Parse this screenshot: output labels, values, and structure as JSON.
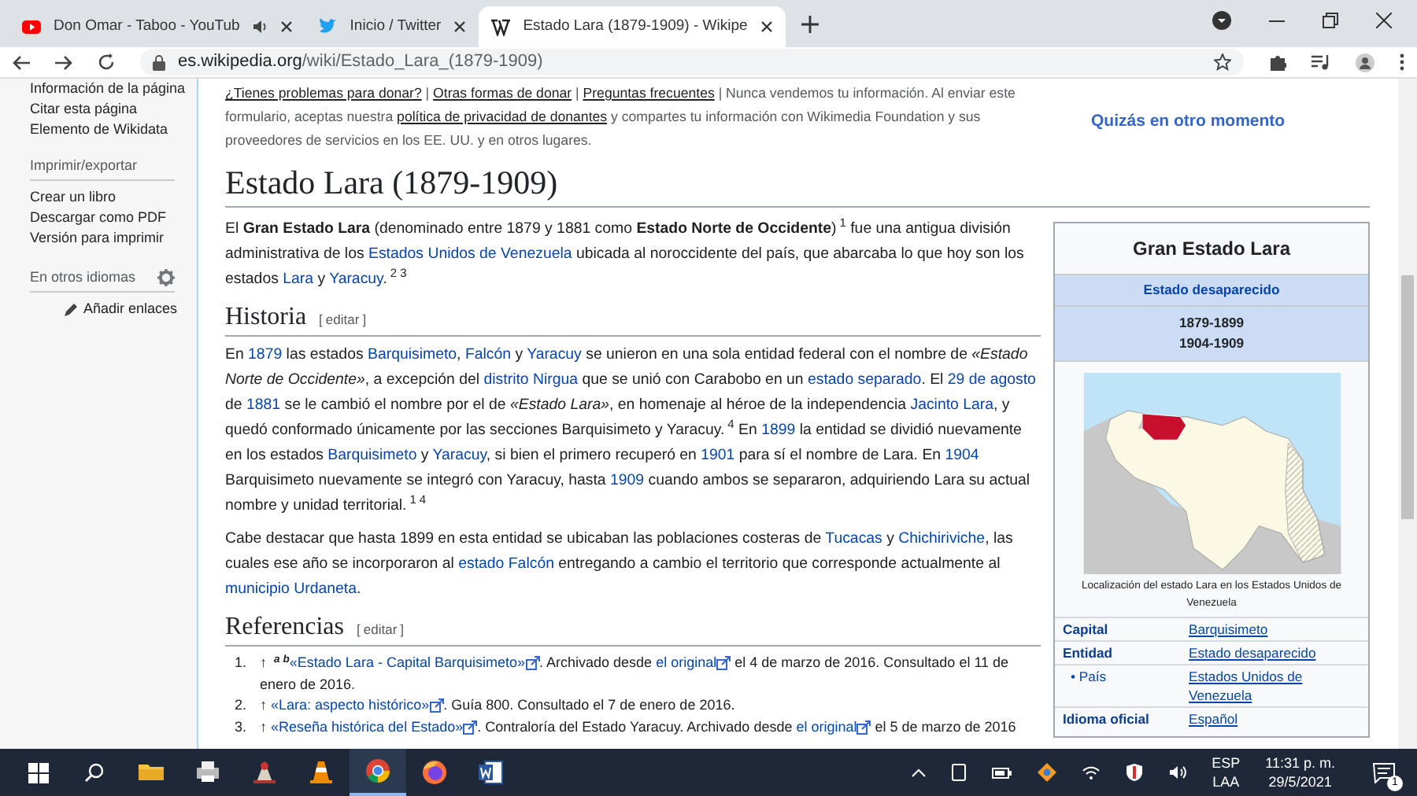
{
  "browser": {
    "tabs": [
      {
        "title": "Don Omar - Taboo - YouTub",
        "kind": "youtube",
        "selected": false,
        "playing_audio": true
      },
      {
        "title": "Inicio / Twitter",
        "kind": "twitter",
        "selected": false,
        "playing_audio": false
      },
      {
        "title": "Estado Lara (1879-1909) - Wikipe",
        "kind": "wikipedia",
        "selected": true,
        "playing_audio": false
      }
    ],
    "url_host": "es.wikipedia.org",
    "url_path": "/wiki/Estado_Lara_(1879-1909)"
  },
  "sidebar": {
    "top_links": [
      "Información de la página",
      "Citar esta página",
      "Elemento de Wikidata"
    ],
    "sections": [
      {
        "heading": "Imprimir/exportar",
        "links": [
          "Crear un libro",
          "Descargar como PDF",
          "Versión para imprimir"
        ]
      }
    ],
    "languages": {
      "heading": "En otros idiomas",
      "add_links": "Añadir enlaces"
    }
  },
  "banner": {
    "segments": [
      {
        "kind": "ulink",
        "text": "¿Tienes problemas para donar?"
      },
      {
        "kind": "text",
        "text": " | "
      },
      {
        "kind": "ulink",
        "text": "Otras formas de donar"
      },
      {
        "kind": "text",
        "text": " | "
      },
      {
        "kind": "ulink",
        "text": "Preguntas frecuentes"
      },
      {
        "kind": "text",
        "text": " | Nunca vendemos tu información. Al enviar este formulario, aceptas nuestra "
      },
      {
        "kind": "ulink",
        "text": "política de privacidad de donantes"
      },
      {
        "kind": "text",
        "text": " y compartes tu información con Wikimedia Foundation y sus proveedores de servicios en los EE. UU. y en otros lugares."
      }
    ],
    "action": "Quizás en otro momento"
  },
  "article": {
    "title": "Estado Lara (1879-1909)",
    "intro": [
      [
        {
          "kind": "text",
          "text": "El "
        },
        {
          "kind": "bold",
          "text": "Gran Estado Lara"
        },
        {
          "kind": "text",
          "text": " (denominado entre 1879 y 1881 como "
        },
        {
          "kind": "bold",
          "text": "Estado Norte de Occidente"
        },
        {
          "kind": "text",
          "text": ")"
        },
        {
          "kind": "ref",
          "text": "1"
        },
        {
          "kind": "text",
          "text": "  fue una antigua división administrativa de los "
        },
        {
          "kind": "link",
          "text": "Estados Unidos de Venezuela"
        },
        {
          "kind": "text",
          "text": " ubicada al noroccidente del país, que abarcaba lo que hoy son los estados "
        },
        {
          "kind": "link",
          "text": "Lara"
        },
        {
          "kind": "text",
          "text": " y "
        },
        {
          "kind": "link",
          "text": "Yaracuy"
        },
        {
          "kind": "text",
          "text": "."
        },
        {
          "kind": "ref",
          "text": "2"
        },
        {
          "kind": "ref",
          "text": "3"
        }
      ]
    ],
    "sections": [
      {
        "heading": "Historia",
        "edit_open": "[",
        "edit": "editar",
        "edit_close": "]",
        "paragraphs": [
          [
            {
              "kind": "text",
              "text": "En "
            },
            {
              "kind": "link",
              "text": "1879"
            },
            {
              "kind": "text",
              "text": " las estados "
            },
            {
              "kind": "link",
              "text": "Barquisimeto"
            },
            {
              "kind": "text",
              "text": ", "
            },
            {
              "kind": "link",
              "text": "Falcón"
            },
            {
              "kind": "text",
              "text": " y "
            },
            {
              "kind": "link",
              "text": "Yaracuy"
            },
            {
              "kind": "text",
              "text": " se unieron en una sola entidad federal con el nombre de "
            },
            {
              "kind": "italic",
              "text": "«Estado Norte de Occidente»"
            },
            {
              "kind": "text",
              "text": ", a excepción del "
            },
            {
              "kind": "link",
              "text": "distrito Nirgua"
            },
            {
              "kind": "text",
              "text": " que se unió con Carabobo en un "
            },
            {
              "kind": "link",
              "text": "estado separado"
            },
            {
              "kind": "text",
              "text": ". El "
            },
            {
              "kind": "link",
              "text": "29 de agosto"
            },
            {
              "kind": "text",
              "text": " de "
            },
            {
              "kind": "link",
              "text": "1881"
            },
            {
              "kind": "text",
              "text": " se le cambió el nombre por el de "
            },
            {
              "kind": "italic",
              "text": "«Estado Lara»"
            },
            {
              "kind": "text",
              "text": ", en homenaje al héroe de la independencia "
            },
            {
              "kind": "link",
              "text": "Jacinto Lara"
            },
            {
              "kind": "text",
              "text": ", y quedó conformado únicamente por las secciones Barquisimeto y Yaracuy."
            },
            {
              "kind": "ref",
              "text": "4"
            },
            {
              "kind": "text",
              "text": "  En "
            },
            {
              "kind": "link",
              "text": "1899"
            },
            {
              "kind": "text",
              "text": " la entidad se dividió nuevamente en los estados "
            },
            {
              "kind": "link",
              "text": "Barquisimeto"
            },
            {
              "kind": "text",
              "text": " y "
            },
            {
              "kind": "link",
              "text": "Yaracuy"
            },
            {
              "kind": "text",
              "text": ", si bien el primero recuperó en "
            },
            {
              "kind": "link",
              "text": "1901"
            },
            {
              "kind": "text",
              "text": " para sí el nombre de Lara. En "
            },
            {
              "kind": "link",
              "text": "1904"
            },
            {
              "kind": "text",
              "text": " Barquisimeto nuevamente se integró con Yaracuy, hasta "
            },
            {
              "kind": "link",
              "text": "1909"
            },
            {
              "kind": "text",
              "text": " cuando ambos se separaron, adquiriendo Lara su actual nombre y unidad territorial."
            },
            {
              "kind": "ref",
              "text": "1"
            },
            {
              "kind": "ref",
              "text": "4"
            }
          ],
          [
            {
              "kind": "text",
              "text": "Cabe destacar que hasta 1899 en esta entidad se ubicaban las poblaciones costeras de "
            },
            {
              "kind": "link",
              "text": "Tucacas"
            },
            {
              "kind": "text",
              "text": " y "
            },
            {
              "kind": "link",
              "text": "Chichiriviche"
            },
            {
              "kind": "text",
              "text": ", las cuales ese año se incorporaron al "
            },
            {
              "kind": "link",
              "text": "estado Falcón"
            },
            {
              "kind": "text",
              "text": " entregando a cambio el territorio que corresponde actualmente al "
            },
            {
              "kind": "link",
              "text": "municipio Urdaneta"
            },
            {
              "kind": "text",
              "text": "."
            }
          ]
        ]
      },
      {
        "heading": "Referencias",
        "edit_open": "[",
        "edit": "editar",
        "edit_close": "]",
        "references": [
          {
            "number": "1.",
            "segments": [
              {
                "kind": "text",
                "text": "↑ "
              },
              {
                "kind": "backref",
                "text": "a"
              },
              {
                "kind": "backref",
                "text": "b"
              },
              {
                "kind": "extlink",
                "text": "«Estado Lara - Capital Barquisimeto»"
              },
              {
                "kind": "text",
                "text": ". Archivado desde "
              },
              {
                "kind": "extlink",
                "text": "el original"
              },
              {
                "kind": "text",
                "text": " el 4 de marzo de 2016. Consultado el 11 de enero de 2016."
              }
            ]
          },
          {
            "number": "2.",
            "segments": [
              {
                "kind": "text",
                "text": "↑ "
              },
              {
                "kind": "extlink",
                "text": "«Lara: aspecto histórico»"
              },
              {
                "kind": "text",
                "text": ". Guía 800. Consultado el 7 de enero de 2016."
              }
            ]
          },
          {
            "number": "3.",
            "segments": [
              {
                "kind": "text",
                "text": "↑ "
              },
              {
                "kind": "extlink",
                "text": "«Reseña histórica del Estado»"
              },
              {
                "kind": "text",
                "text": ". Contraloría del Estado Yaracuy. Archivado desde "
              },
              {
                "kind": "extlink",
                "text": "el original"
              },
              {
                "kind": "text",
                "text": " el 5 de marzo de 2016"
              }
            ]
          }
        ]
      }
    ]
  },
  "infobox": {
    "title": "Gran Estado Lara",
    "subtitle": "Estado desaparecido",
    "periods": [
      "1879-1899",
      "1904-1909"
    ],
    "map_caption": "Localización del estado Lara en los Estados Unidos de Venezuela",
    "rows": [
      {
        "label": "Capital",
        "value": "Barquisimeto",
        "kind": "main"
      },
      {
        "label": "Entidad",
        "value": "Estado desaparecido",
        "kind": "main"
      },
      {
        "label": "• País",
        "value": "Estados Unidos de Venezuela",
        "kind": "sub"
      },
      {
        "label": "Idioma oficial",
        "value": "Español",
        "kind": "main"
      }
    ]
  },
  "taskbar": {
    "apps": [
      {
        "kind": "explorer",
        "active": false
      },
      {
        "kind": "printer",
        "active": false
      },
      {
        "kind": "paint",
        "active": false
      },
      {
        "kind": "vlc",
        "active": false
      },
      {
        "kind": "chrome",
        "active": true
      },
      {
        "kind": "firefox",
        "active": false
      },
      {
        "kind": "word",
        "active": false
      }
    ],
    "language": "ESP",
    "layout": "LAA",
    "time": "11:31 p. m.",
    "date": "29/5/2021",
    "notifications": "1"
  }
}
